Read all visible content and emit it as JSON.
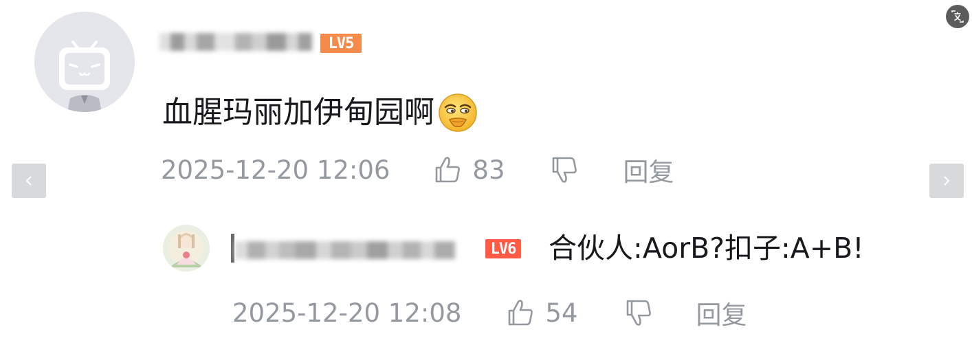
{
  "colors": {
    "badge_lv5": "#f58a4b",
    "badge_lv6": "#ff5a45",
    "meta_text": "#9499a0",
    "body_text": "#18191c",
    "nav_bg": "#d8d9db"
  },
  "icons": {
    "prev": "chevron-left-icon",
    "next": "chevron-right-icon",
    "translate": "translate-icon",
    "like": "thumbs-up-icon",
    "dislike": "thumbs-down-icon",
    "emoji": "smug-face-emoji-icon"
  },
  "comment": {
    "level_badge": "LV5",
    "text": "血腥玛丽加伊甸园啊",
    "time": "2025-12-20 12:06",
    "likes": "83",
    "reply_label": "回复"
  },
  "reply": {
    "level_badge": "LV6",
    "text": "合伙人:AorB?扣子:A+B!",
    "time": "2025-12-20 12:08",
    "likes": "54",
    "reply_label": "回复"
  }
}
